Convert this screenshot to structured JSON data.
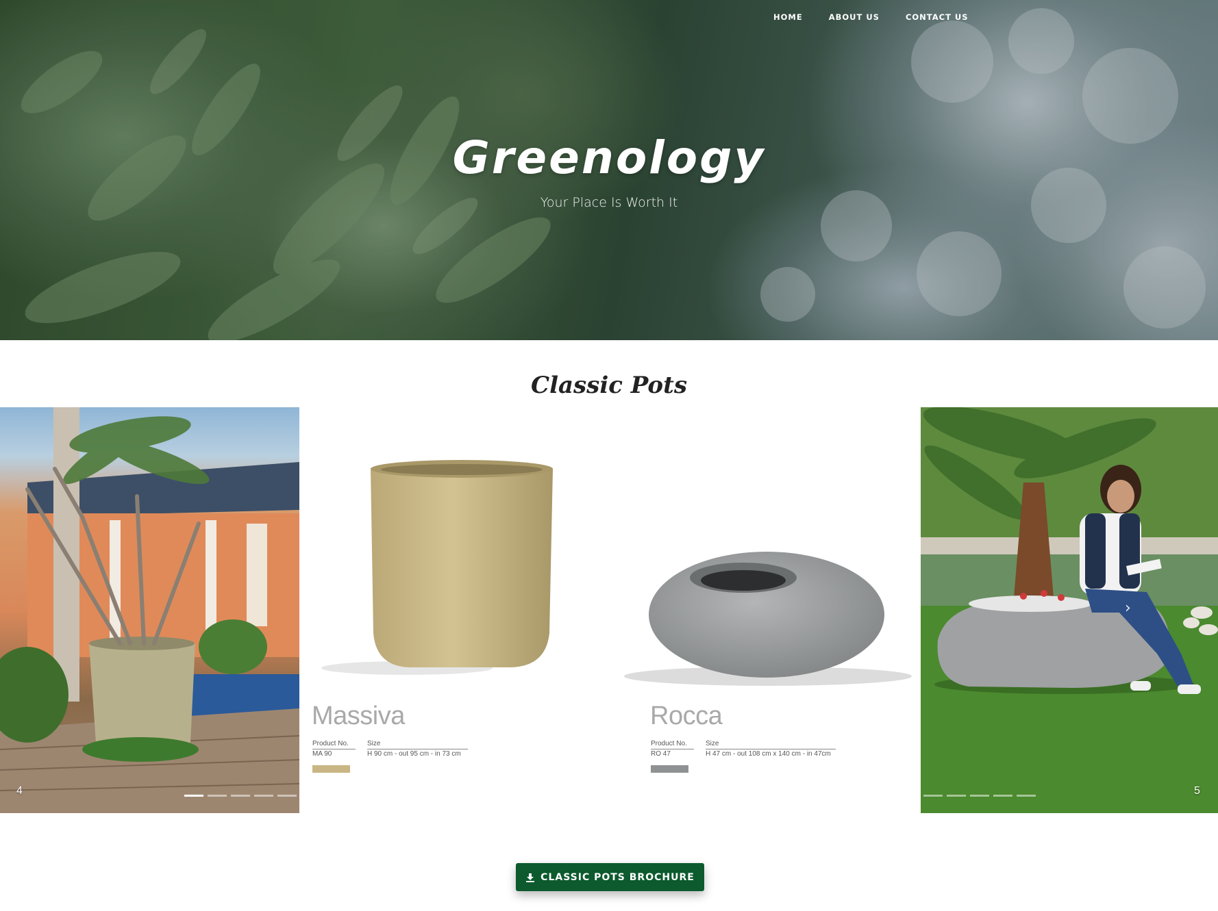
{
  "nav": {
    "items": [
      {
        "label": "HOME"
      },
      {
        "label": "ABOUT US"
      },
      {
        "label": "CONTACT US"
      }
    ]
  },
  "hero": {
    "brand": "Greenology",
    "tagline": "Your Place Is Worth It"
  },
  "section": {
    "title": "Classic Pots"
  },
  "carousel": {
    "left_slide_number": "4",
    "right_slide_number": "5",
    "products": [
      {
        "name": "Massiva",
        "product_no_label": "Product No.",
        "product_no": "MA 90",
        "size_label": "Size",
        "size": "H 90 cm - out 95 cm - in 73 cm",
        "swatch_color": "#c9b684"
      },
      {
        "name": "Rocca",
        "product_no_label": "Product No.",
        "product_no": "RO 47",
        "size_label": "Size",
        "size": "H 47 cm - out 108 cm x 140 cm - in 47cm",
        "swatch_color": "#8f9293"
      }
    ],
    "icons": {
      "next": "chevron-right-icon"
    }
  },
  "brochure_button": {
    "label": "CLASSIC POTS BROCHURE",
    "icon": "download-icon",
    "color": "#0c5a2e"
  }
}
